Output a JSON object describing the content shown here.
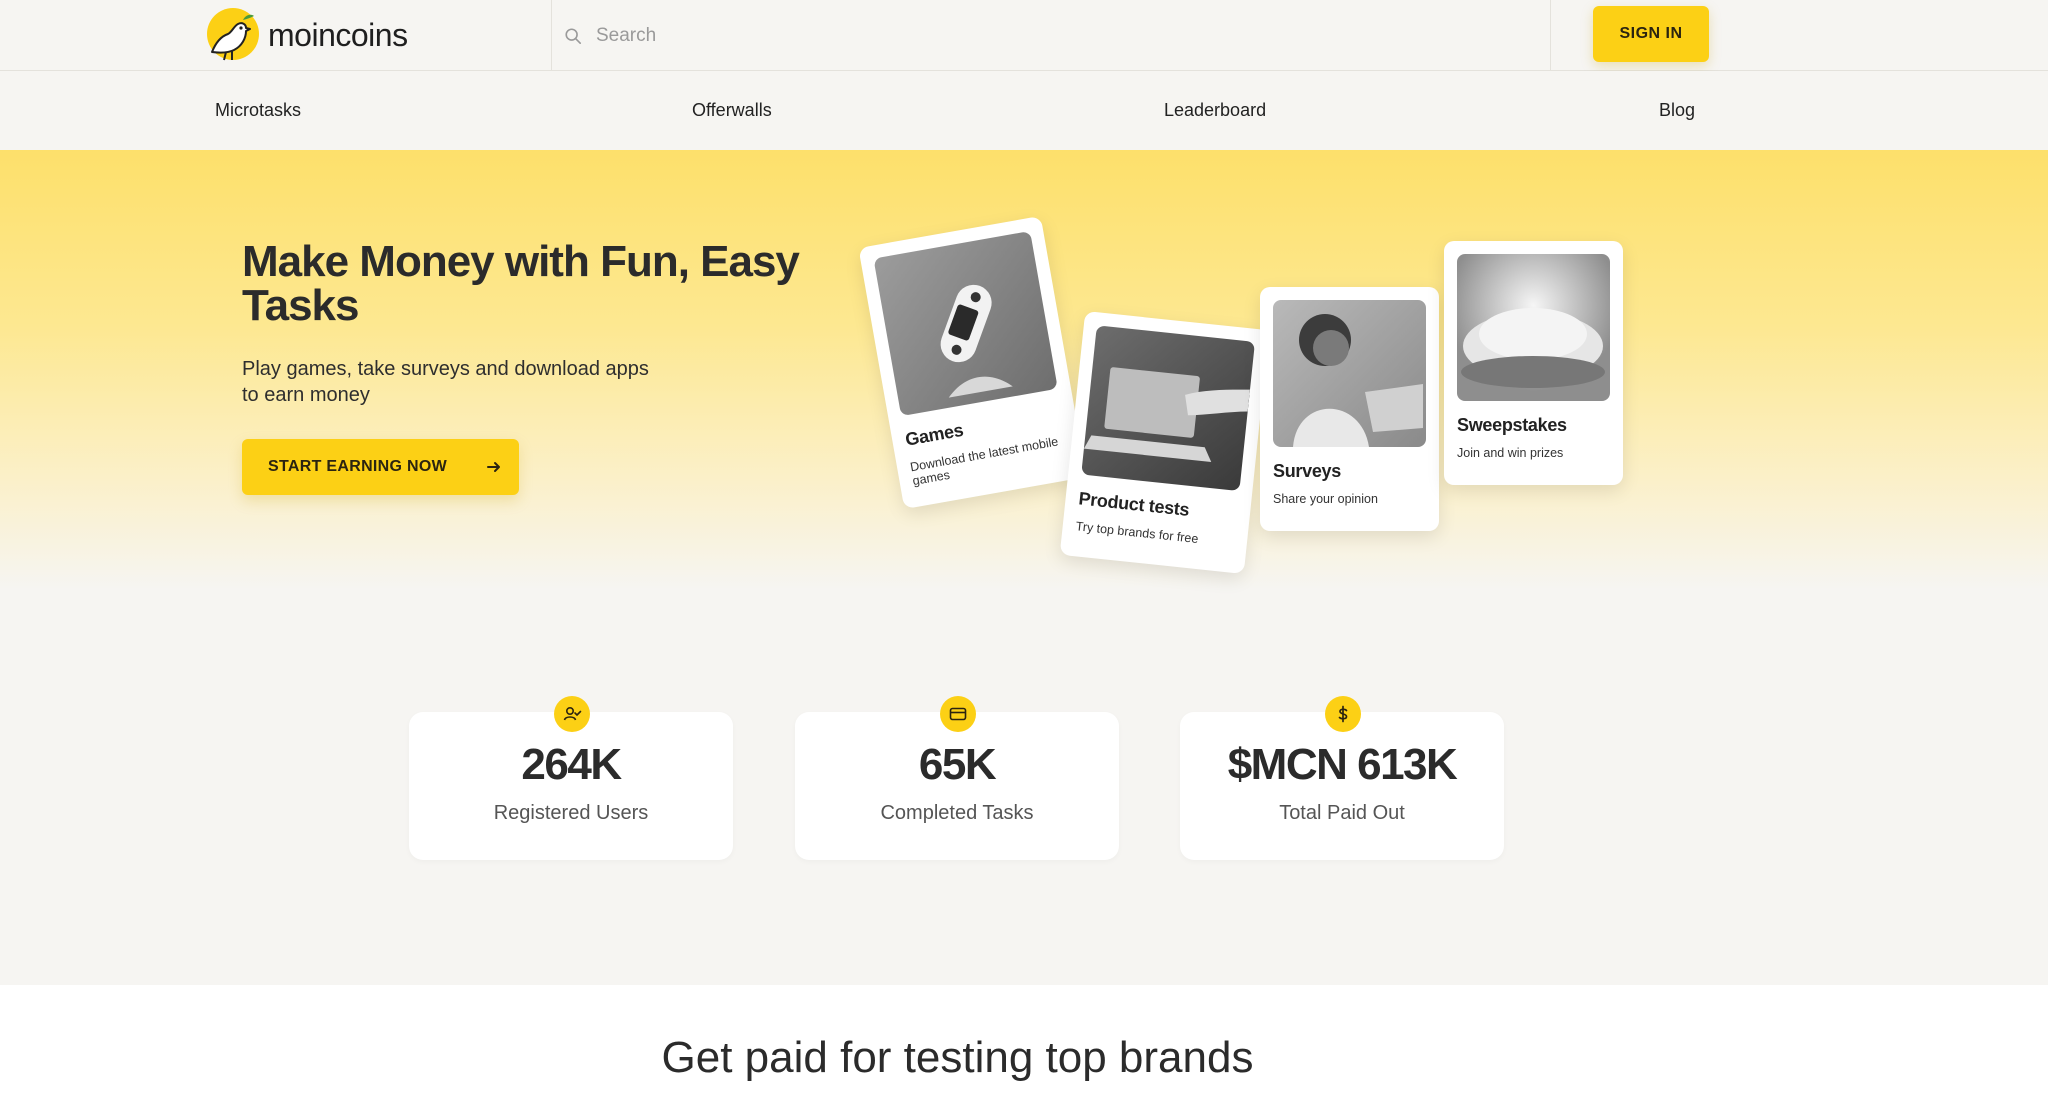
{
  "brand": {
    "name": "moincoins"
  },
  "search": {
    "placeholder": "Search"
  },
  "header": {
    "signin_label": "SIGN IN"
  },
  "nav": {
    "items": [
      "Microtasks",
      "Offerwalls",
      "Leaderboard",
      "Blog"
    ]
  },
  "hero": {
    "title": "Make Money with Fun, Easy Tasks",
    "subtitle": "Play games, take surveys and download apps to earn money",
    "cta_label": "START EARNING NOW"
  },
  "cards": [
    {
      "title": "Games",
      "description": "Download the latest mobile games"
    },
    {
      "title": "Product tests",
      "description": "Try top brands for free"
    },
    {
      "title": "Surveys",
      "description": "Share your opinion"
    },
    {
      "title": "Sweepstakes",
      "description": "Join and win prizes"
    }
  ],
  "stats": [
    {
      "value": "264K",
      "label": "Registered Users",
      "icon": "user-check-icon"
    },
    {
      "value": "65K",
      "label": "Completed Tasks",
      "icon": "card-icon"
    },
    {
      "value": "$MCN 613K",
      "label": "Total Paid Out",
      "icon": "dollar-icon"
    }
  ],
  "section": {
    "title": "Get paid for testing top brands"
  },
  "colors": {
    "accent": "#fcd015",
    "hero_top": "#fde06b",
    "background": "#f6f5f2"
  }
}
